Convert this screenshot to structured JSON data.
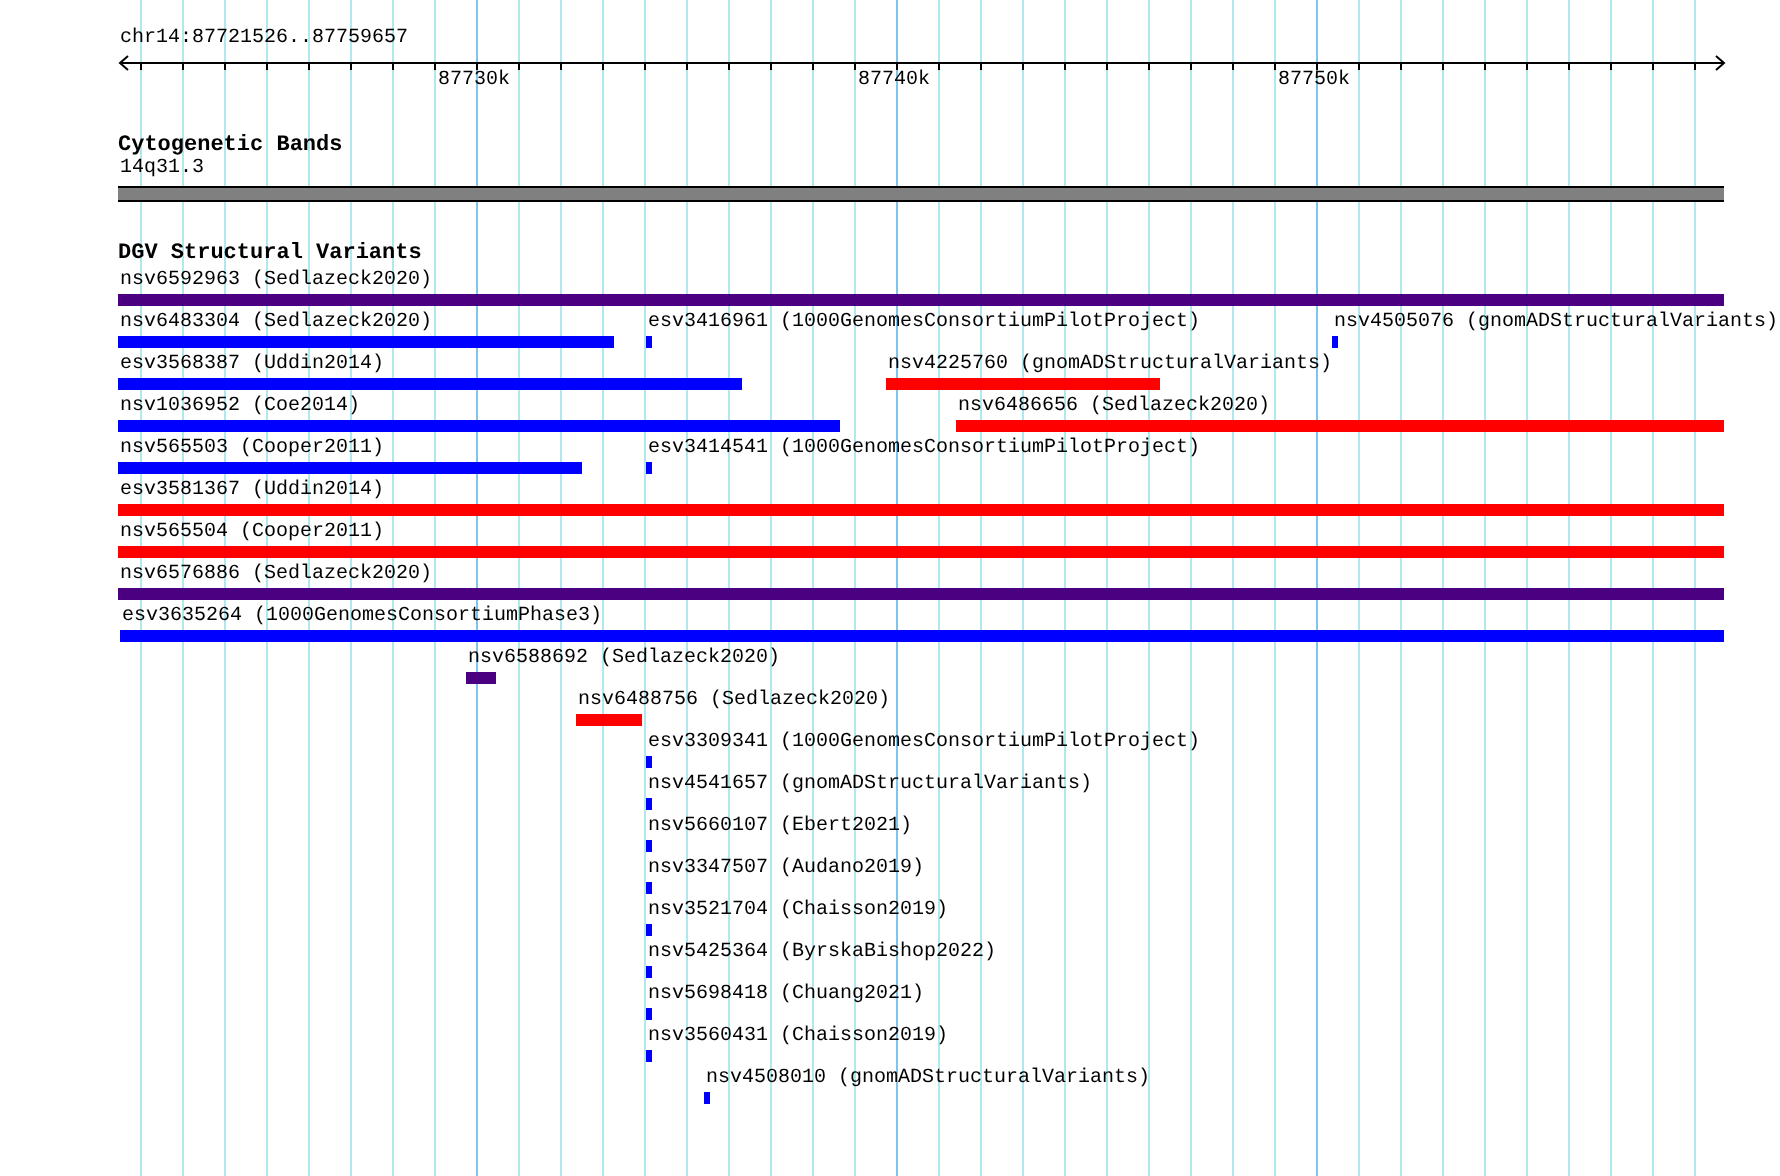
{
  "ruler": {
    "location": "chr14:87721526..87759657",
    "ticks": [
      "87730k",
      "87740k",
      "87750k"
    ]
  },
  "tracks": [
    {
      "title": "Cytogenetic Bands",
      "kind": "bands",
      "features": [
        {
          "label": "14q31.3"
        }
      ]
    },
    {
      "title": "DGV Structural Variants",
      "kind": "variants",
      "features": [
        {
          "label": "nsv6592963 (Sedlazeck2020)",
          "color": "#4b0082"
        },
        {
          "label": "nsv6483304 (Sedlazeck2020)",
          "color": "#0000ff"
        },
        {
          "label": "esv3416961 (1000GenomesConsortiumPilotProject)",
          "color": "#0000ff"
        },
        {
          "label": "nsv4505076 (gnomADStructuralVariants)",
          "color": "#0000ff"
        },
        {
          "label": "esv3568387 (Uddin2014)",
          "color": "#0000ff"
        },
        {
          "label": "nsv4225760 (gnomADStructuralVariants)",
          "color": "#ff0000"
        },
        {
          "label": "nsv1036952 (Coe2014)",
          "color": "#0000ff"
        },
        {
          "label": "nsv6486656 (Sedlazeck2020)",
          "color": "#ff0000"
        },
        {
          "label": "nsv565503 (Cooper2011)",
          "color": "#0000ff"
        },
        {
          "label": "esv3414541 (1000GenomesConsortiumPilotProject)",
          "color": "#0000ff"
        },
        {
          "label": "esv3581367 (Uddin2014)",
          "color": "#ff0000"
        },
        {
          "label": "nsv565504 (Cooper2011)",
          "color": "#ff0000"
        },
        {
          "label": "nsv6576886 (Sedlazeck2020)",
          "color": "#4b0082"
        },
        {
          "label": "esv3635264 (1000GenomesConsortiumPhase3)",
          "color": "#0000ff"
        },
        {
          "label": "nsv6588692 (Sedlazeck2020)",
          "color": "#4b0082"
        },
        {
          "label": "nsv6488756 (Sedlazeck2020)",
          "color": "#ff0000"
        },
        {
          "label": "esv3309341 (1000GenomesConsortiumPilotProject)",
          "color": "#0000ff"
        },
        {
          "label": "nsv4541657 (gnomADStructuralVariants)",
          "color": "#0000ff"
        },
        {
          "label": "nsv5660107 (Ebert2021)",
          "color": "#0000ff"
        },
        {
          "label": "nsv3347507 (Audano2019)",
          "color": "#0000ff"
        },
        {
          "label": "nsv3521704 (Chaisson2019)",
          "color": "#0000ff"
        },
        {
          "label": "nsv5425364 (ByrskaBishop2022)",
          "color": "#0000ff"
        },
        {
          "label": "nsv5698418 (Chuang2021)",
          "color": "#0000ff"
        },
        {
          "label": "nsv3560431 (Chaisson2019)",
          "color": "#0000ff"
        },
        {
          "label": "nsv4508010 (gnomADStructuralVariants)",
          "color": "#0000ff"
        }
      ]
    }
  ]
}
